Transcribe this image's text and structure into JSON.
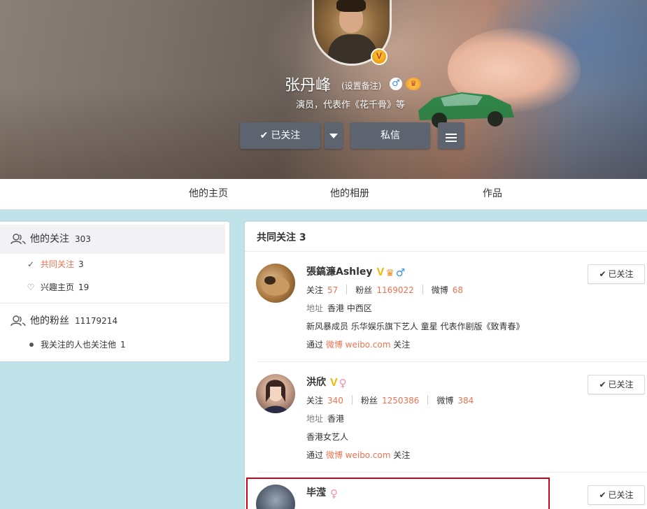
{
  "profile": {
    "name": "张丹峰",
    "remark": "(设置备注)",
    "bio": "演员，代表作《花千骨》等",
    "follow_button": "已关注",
    "message_button": "私信"
  },
  "nav": {
    "tabs": [
      "他的主页",
      "他的相册",
      "作品"
    ]
  },
  "sidebar": {
    "following": {
      "label": "他的关注",
      "count": "303"
    },
    "mutual": {
      "label": "共同关注",
      "count": "3"
    },
    "interest": {
      "label": "兴趣主页",
      "count": "19"
    },
    "fans": {
      "label": "他的粉丝",
      "count": "11179214"
    },
    "fans_mutual": {
      "label": "我关注的人也关注他",
      "count": "1"
    }
  },
  "main": {
    "header": "共同关注 3",
    "users": [
      {
        "name": "張鎬濂Ashley",
        "follow_label": "关注",
        "follow_count": "57",
        "fans_label": "粉丝",
        "fans_count": "1169022",
        "weibo_label": "微博",
        "weibo_count": "68",
        "address_label": "地址",
        "address": "香港 中西区",
        "desc": "新风暴成员 乐华娱乐旗下艺人 童星 代表作剧版《致青春》",
        "via_label": "通过",
        "via_link": "微博 weibo.com",
        "via_suffix": "关注",
        "button": "已关注"
      },
      {
        "name": "洪欣",
        "follow_label": "关注",
        "follow_count": "340",
        "fans_label": "粉丝",
        "fans_count": "1250386",
        "weibo_label": "微博",
        "weibo_count": "384",
        "address_label": "地址",
        "address": "香港",
        "desc": "香港女艺人",
        "via_label": "通过",
        "via_link": "微博 weibo.com",
        "via_suffix": "关注",
        "button": "已关注"
      },
      {
        "name": "毕滢",
        "button": "已关注"
      }
    ]
  },
  "colors": {
    "accent": "#eb7350",
    "button_dark": "#5d6470",
    "page_bg": "#c0e3ea",
    "highlight": "#d0021b"
  }
}
